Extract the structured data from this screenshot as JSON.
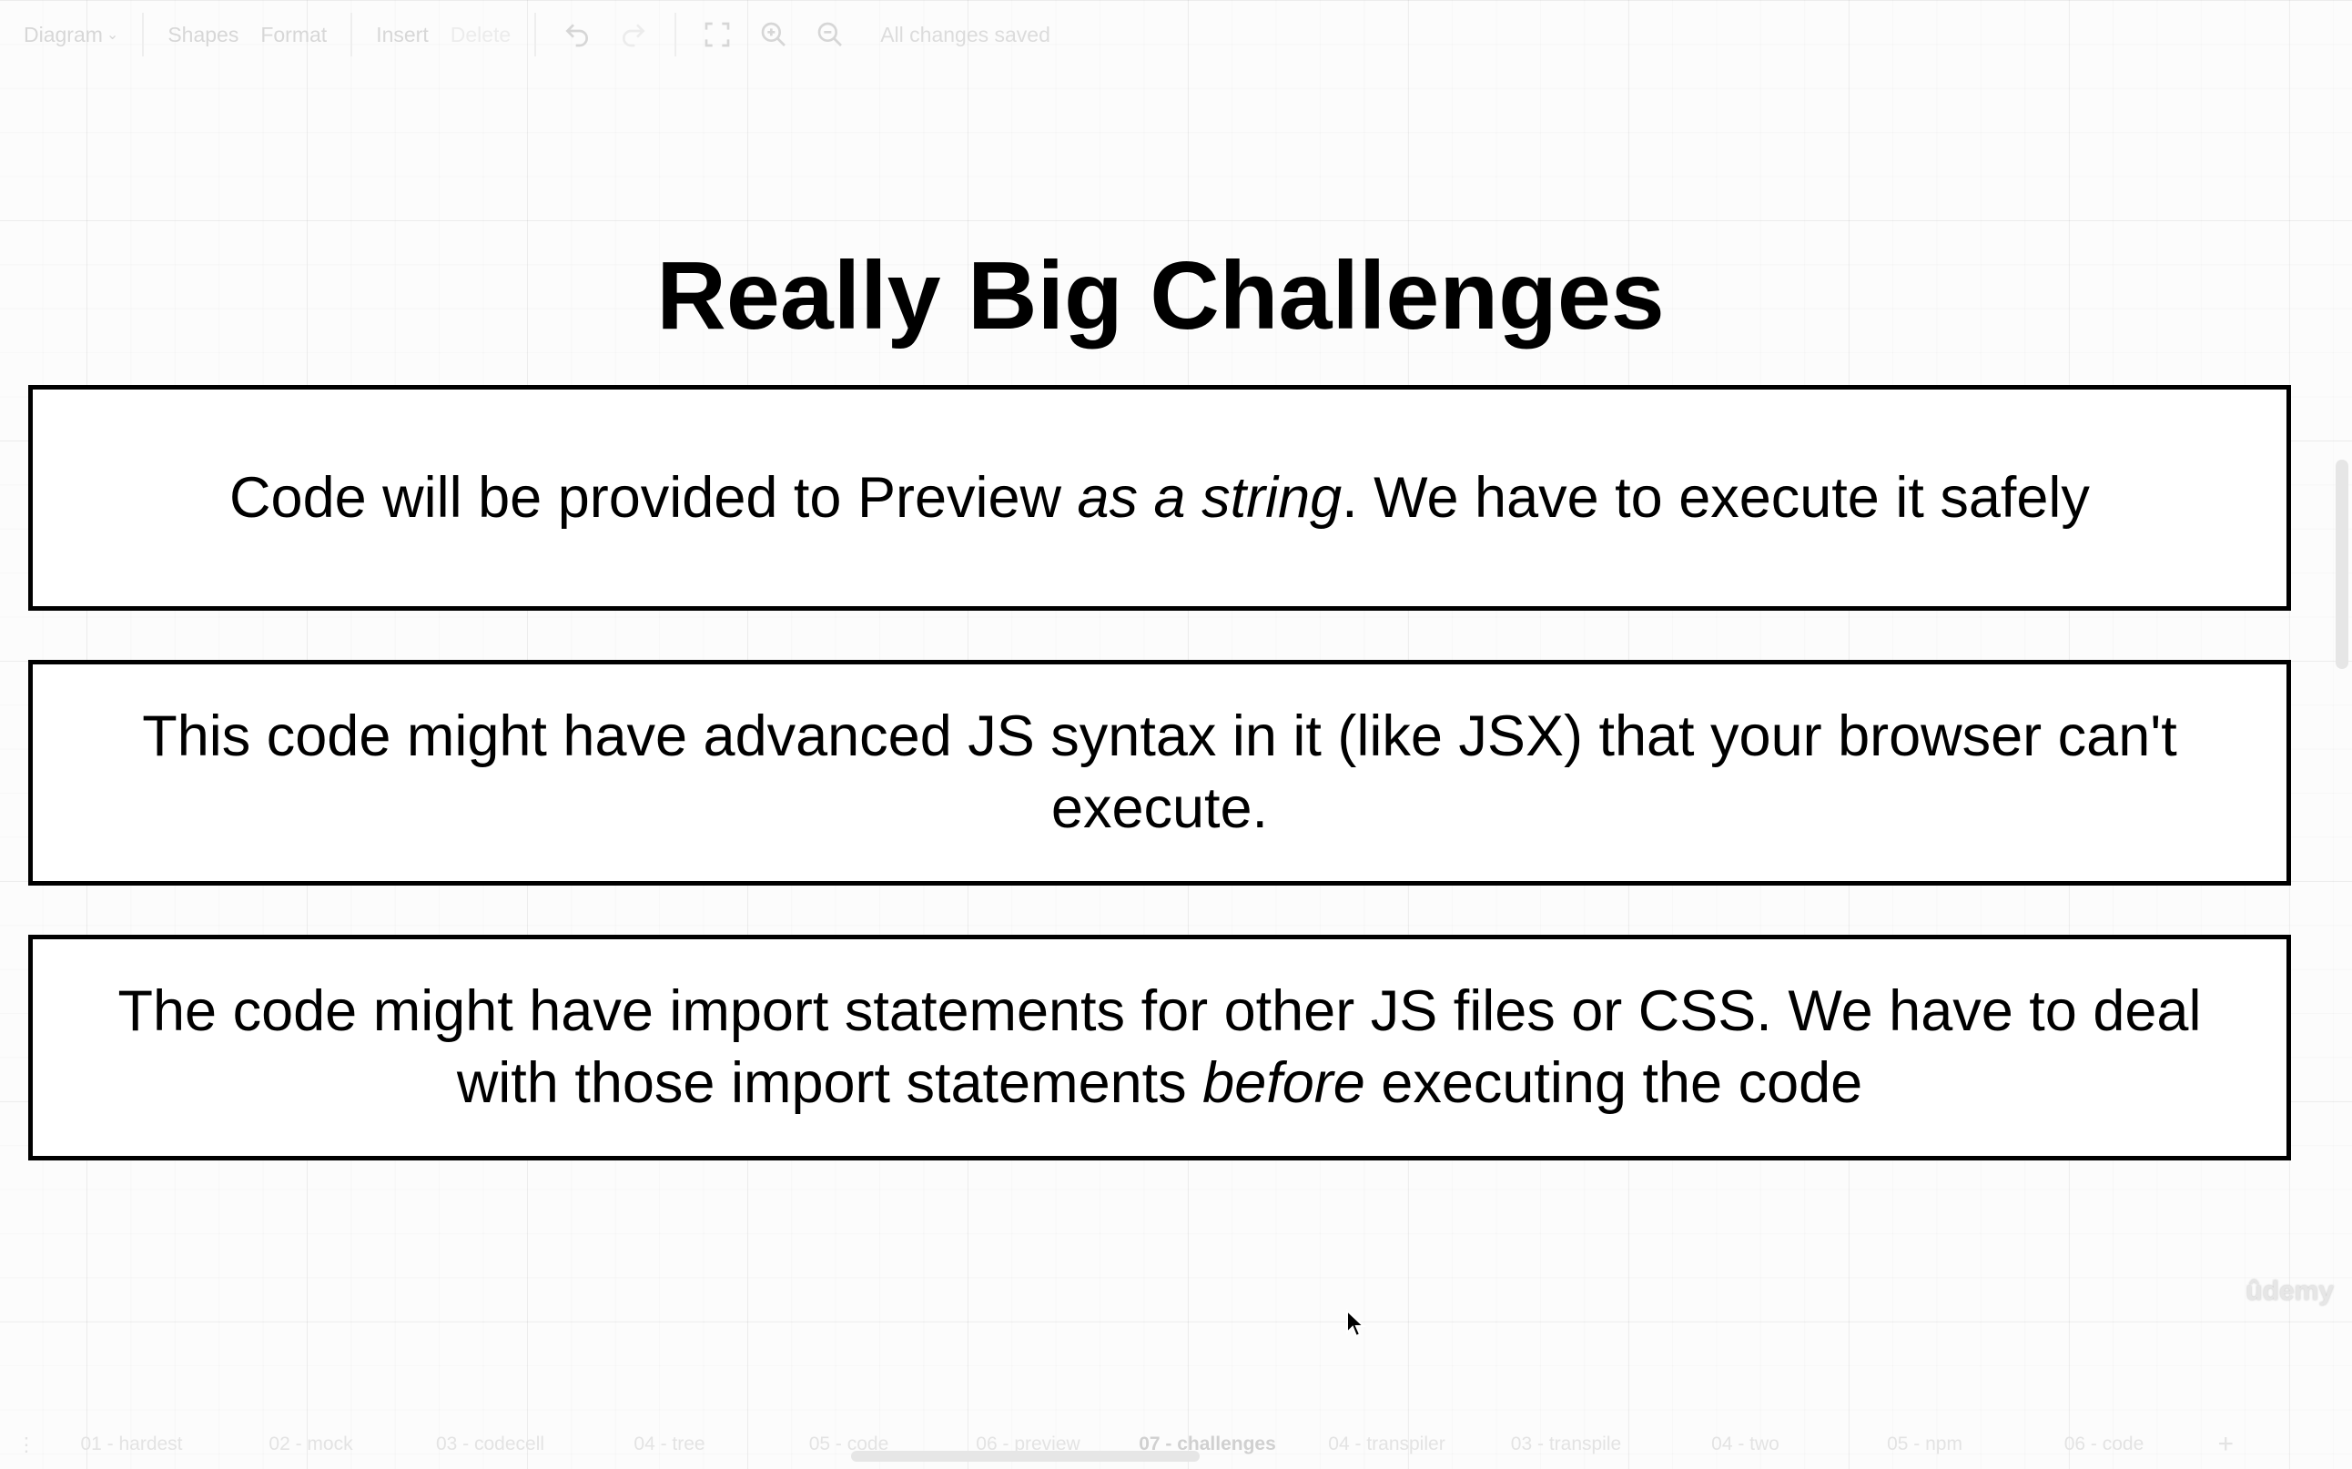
{
  "toolbar": {
    "diagram_label": "Diagram",
    "shapes_label": "Shapes",
    "format_label": "Format",
    "insert_label": "Insert",
    "delete_label": "Delete",
    "status": "All changes saved",
    "icons": [
      "undo-icon",
      "redo-icon",
      "fullscreen-icon",
      "zoom-in-icon",
      "zoom-out-icon"
    ]
  },
  "slide": {
    "title": "Really Big Challenges",
    "box1": {
      "before": "Code will be provided to Preview ",
      "emph": "as a string",
      "after": ". We have to execute it safely"
    },
    "box2": {
      "text": "This code might have advanced JS syntax in it (like JSX) that your browser can't execute."
    },
    "box3": {
      "before": "The code might have import statements for other JS files or CSS. We have to deal with those import statements ",
      "emph": "before",
      "after": " executing the code"
    }
  },
  "watermark": "ûdemy",
  "tabs": [
    {
      "label": "01 - hardest"
    },
    {
      "label": "02 - mock"
    },
    {
      "label": "03 - codecell"
    },
    {
      "label": "04 - tree"
    },
    {
      "label": "05 - code"
    },
    {
      "label": "06 - preview"
    },
    {
      "label": "07 - challenges"
    },
    {
      "label": "04 - transpiler"
    },
    {
      "label": "03 - transpile"
    },
    {
      "label": "04 - two"
    },
    {
      "label": "05 - npm"
    },
    {
      "label": "06 - code"
    }
  ],
  "active_tab": "07 - challenges",
  "tab_add": "+",
  "tab_menu": "⋮"
}
